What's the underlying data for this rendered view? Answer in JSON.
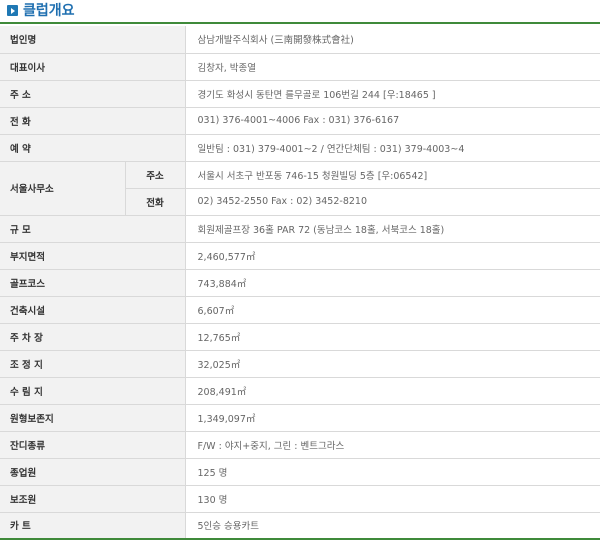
{
  "title": "클럽개요",
  "rows": [
    {
      "label": "법인명",
      "value": "삼남개발주식회사 (三南開發株式會社)"
    },
    {
      "label": "대표이사",
      "value": "김창자, 박종열"
    },
    {
      "label": "주 소",
      "value": "경기도 화성시 동탄면 를무골로 106번길 244 [우:18465 ]"
    },
    {
      "label": "전 화",
      "value": "031) 376-4001~4006 Fax : 031) 376-6167"
    },
    {
      "label": "예 약",
      "value": "일반팀 : 031) 379-4001~2 / 연간단체팀 : 031) 379-4003~4"
    }
  ],
  "seoul_office": {
    "label": "서울사무소",
    "address_label": "주소",
    "address_value": "서울시 서초구 반포동 746-15 청원빌딩 5층 [우:06542]",
    "phone_label": "전화",
    "phone_value": "02) 3452-2550 Fax : 02) 3452-8210"
  },
  "rows2": [
    {
      "label": "규 모",
      "value": "회원제골프장 36홀 PAR 72 (동남코스 18홀, 서북코스 18홀)"
    },
    {
      "label": "부지면적",
      "value": "2,460,577㎡"
    },
    {
      "label": "골프코스",
      "value": "743,884㎡"
    },
    {
      "label": "건축시설",
      "value": "6,607㎡"
    },
    {
      "label": "주 차 장",
      "value": "12,765㎡"
    },
    {
      "label": "조 정 지",
      "value": "32,025㎡"
    },
    {
      "label": "수 림 지",
      "value": "208,491㎡"
    },
    {
      "label": "원형보존지",
      "value": "1,349,097㎡"
    },
    {
      "label": "잔디종류",
      "value": "F/W : 야지+중지, 그린 : 벤트그라스"
    },
    {
      "label": "종업원",
      "value": "125 명"
    },
    {
      "label": "보조원",
      "value": "130 명"
    },
    {
      "label": "카 트",
      "value": "5인승 승용카트"
    }
  ]
}
